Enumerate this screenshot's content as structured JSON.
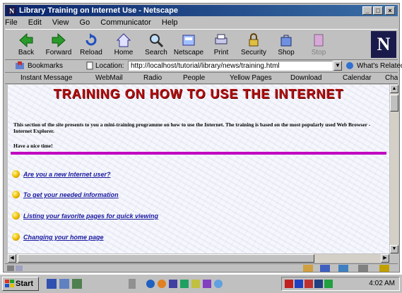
{
  "window": {
    "title": "Library Training on Internet Use - Netscape"
  },
  "menu": [
    "File",
    "Edit",
    "View",
    "Go",
    "Communicator",
    "Help"
  ],
  "toolbar": [
    "Back",
    "Forward",
    "Reload",
    "Home",
    "Search",
    "Netscape",
    "Print",
    "Security",
    "Shop",
    "Stop"
  ],
  "location": {
    "bookmarks_label": "Bookmarks",
    "location_label": "Location:",
    "url": "http://localhost/tutorial/library/news/training.html",
    "related_label": "What's Related"
  },
  "personal_bar": [
    "Instant Message",
    "WebMail",
    "Radio",
    "People",
    "Yellow Pages",
    "Download",
    "Calendar",
    "Chann"
  ],
  "page": {
    "heading": "TRAINING ON HOW TO USE THE INTERNET",
    "intro": "This section of the site presents to you a mini-training programme on how to use the Internet. The training is based on the most popularly used Web Browser - Internet Explorer.",
    "question": "Have a nice time!",
    "links": [
      "Are you a new Internet user?",
      "To get your needed information",
      "Listing your favorite pages for quick viewing",
      "Changing your home page"
    ]
  },
  "taskbar": {
    "start_label": "Start",
    "clock": "4:02 AM"
  },
  "colors": {
    "heading": "#b01010",
    "rule": "#c000c0",
    "link": "#1a1aa0",
    "titlebar": "#0a246a"
  }
}
